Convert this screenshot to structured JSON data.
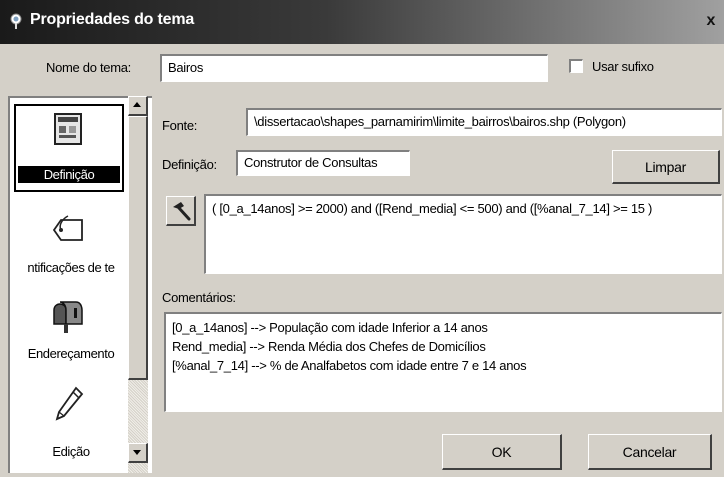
{
  "window": {
    "title": "Propriedades do tema",
    "close_glyph": "x"
  },
  "theme_name": {
    "label": "Nome do tema:",
    "value": "Bairos"
  },
  "suffix": {
    "label": "Usar sufixo",
    "checked": false
  },
  "sidebar": {
    "items": [
      {
        "label": "Definição",
        "icon": "definition-icon",
        "selected": true
      },
      {
        "label": "ntificações de te",
        "icon": "tag-icon",
        "selected": false
      },
      {
        "label": "Endereçamento",
        "icon": "mailbox-icon",
        "selected": false
      },
      {
        "label": "Edição",
        "icon": "pencil-icon",
        "selected": false
      }
    ]
  },
  "source": {
    "label": "Fonte:",
    "value": "\\dissertacao\\shapes_parnamirim\\limite_bairros\\bairos.shp (Polygon)"
  },
  "definition": {
    "label": "Definição:",
    "value": "Construtor de Consultas",
    "clear_button": "Limpar"
  },
  "query": {
    "text": "( [0_a_14anos] >= 2000) and ([Rend_media] <= 500) and ([%anal_7_14] >= 15 )"
  },
  "comments": {
    "label": "Comentários:",
    "lines": [
      "[0_a_14anos] --> População com idade Inferior a 14 anos",
      "Rend_media] --> Renda Média dos Chefes de Domicílios",
      "[%anal_7_14] --> % de Analfabetos com idade entre 7 e 14 anos"
    ]
  },
  "buttons": {
    "ok": "OK",
    "cancel": "Cancelar"
  }
}
